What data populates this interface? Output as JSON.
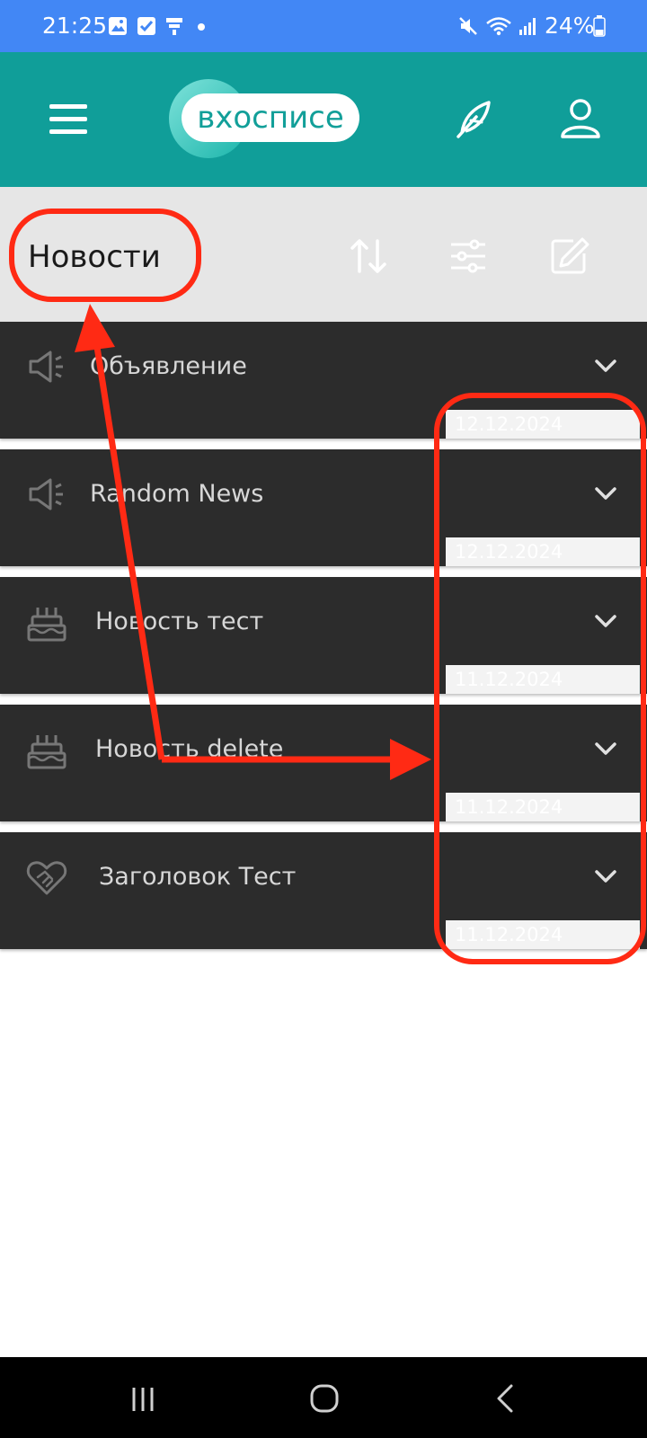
{
  "status_bar": {
    "time": "21:25",
    "battery": "24%",
    "icons": [
      "image-icon",
      "check-icon",
      "sim-icon",
      "dot-icon",
      "mute-icon",
      "wifi-icon",
      "signal-icon",
      "battery-icon"
    ]
  },
  "app_bar": {
    "logo_text": "вхосписе",
    "icons": [
      "menu-icon",
      "feather-icon",
      "profile-icon"
    ]
  },
  "section": {
    "title": "Новости",
    "actions": [
      "sort-icon",
      "filter-icon",
      "edit-icon"
    ]
  },
  "news": [
    {
      "title": "Объявление",
      "date": "12.12.2024",
      "icon": "megaphone-icon"
    },
    {
      "title": "Random News",
      "date": "12.12.2024",
      "icon": "megaphone-icon"
    },
    {
      "title": "Новость тест",
      "date": "11.12.2024",
      "icon": "cake-icon"
    },
    {
      "title": "Новость delete",
      "date": "11.12.2024",
      "icon": "cake-icon"
    },
    {
      "title": "Заголовок Тест",
      "date": "11.12.2024",
      "icon": "handshake-heart-icon"
    }
  ],
  "colors": {
    "status_bar": "#4287f5",
    "app_bar": "#109e99",
    "section_header": "#e6e6e6",
    "news_item": "#2c2c2c",
    "annotation": "#ff2a14",
    "nav_bar": "#000000"
  },
  "nav_bar": {
    "icons": [
      "recents-icon",
      "home-icon",
      "back-icon"
    ]
  }
}
